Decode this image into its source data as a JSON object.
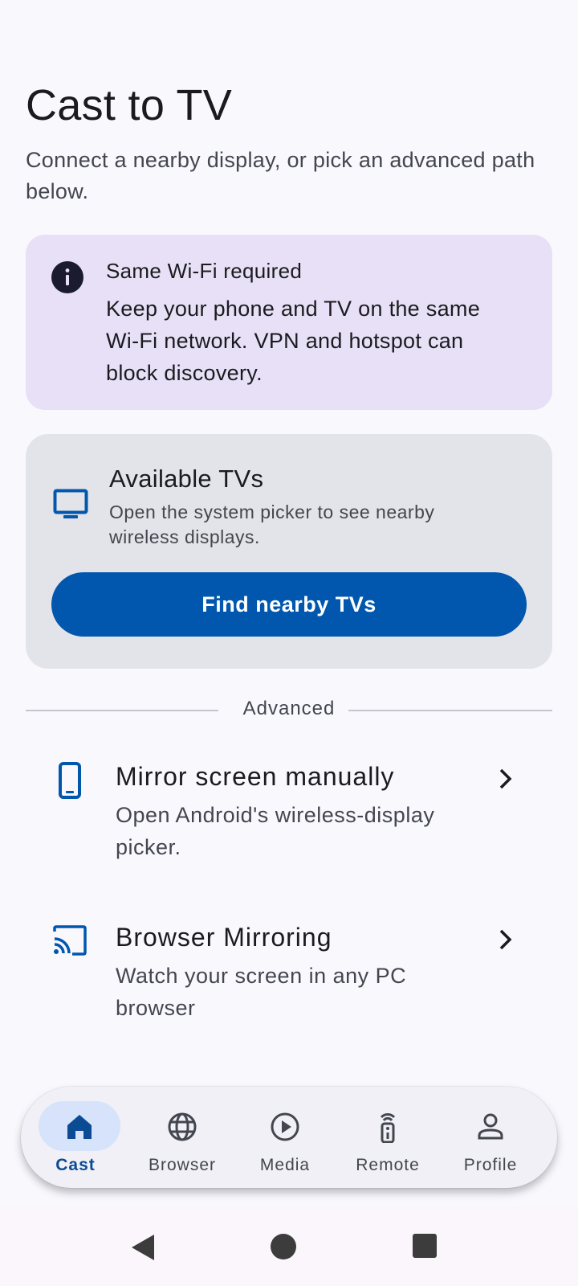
{
  "header": {
    "title": "Cast to TV",
    "subtitle": "Connect a nearby display, or pick an advanced path below."
  },
  "info_card": {
    "icon": "info-icon",
    "title": "Same Wi-Fi required",
    "body": "Keep your phone and TV on the same Wi-Fi network. VPN and hotspot can block discovery."
  },
  "tv_card": {
    "icon": "tv-icon",
    "title": "Available TVs",
    "subtitle": "Open the system picker to see nearby wireless displays.",
    "button_label": "Find nearby TVs"
  },
  "divider": {
    "label": "Advanced"
  },
  "advanced": [
    {
      "icon": "phone-icon",
      "title": "Mirror screen manually",
      "subtitle": "Open Android's wireless-display picker."
    },
    {
      "icon": "cast-icon",
      "title": "Browser Mirroring",
      "subtitle": "Watch your screen in any PC browser"
    }
  ],
  "bottom_nav": [
    {
      "label": "Cast",
      "icon": "home-icon",
      "active": true
    },
    {
      "label": "Browser",
      "icon": "globe-icon",
      "active": false
    },
    {
      "label": "Media",
      "icon": "play-circle-icon",
      "active": false
    },
    {
      "label": "Remote",
      "icon": "remote-icon",
      "active": false
    },
    {
      "label": "Profile",
      "icon": "person-icon",
      "active": false
    }
  ],
  "colors": {
    "accent": "#0057ad",
    "info_bg": "#e7e0f6",
    "card_bg": "#e3e4e9",
    "nav_active_pill": "#d6e3fb"
  }
}
